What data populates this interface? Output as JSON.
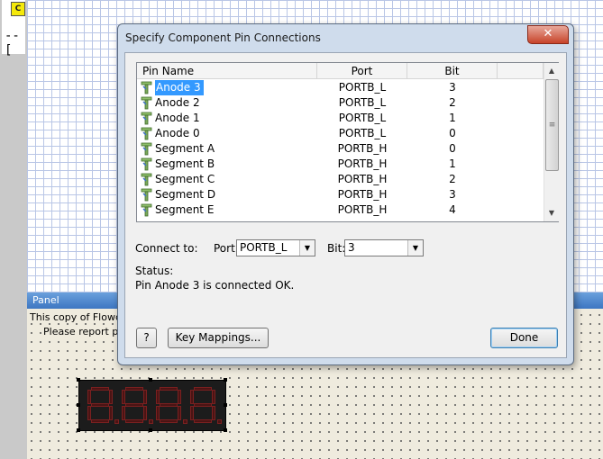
{
  "toolbar": {
    "c_badge": "C",
    "connector_glyph": "--["
  },
  "panel": {
    "title": "Panel",
    "line1": "This copy of Flowcode",
    "line2": "Please report pira"
  },
  "dialog": {
    "title": "Specify Component Pin Connections",
    "close_glyph": "✕",
    "columns": {
      "name": "Pin Name",
      "port": "Port",
      "bit": "Bit"
    },
    "rows": [
      {
        "name": "Anode 3",
        "port": "PORTB_L",
        "bit": "3"
      },
      {
        "name": "Anode 2",
        "port": "PORTB_L",
        "bit": "2"
      },
      {
        "name": "Anode 1",
        "port": "PORTB_L",
        "bit": "1"
      },
      {
        "name": "Anode 0",
        "port": "PORTB_L",
        "bit": "0"
      },
      {
        "name": "Segment A",
        "port": "PORTB_H",
        "bit": "0"
      },
      {
        "name": "Segment B",
        "port": "PORTB_H",
        "bit": "1"
      },
      {
        "name": "Segment C",
        "port": "PORTB_H",
        "bit": "2"
      },
      {
        "name": "Segment D",
        "port": "PORTB_H",
        "bit": "3"
      },
      {
        "name": "Segment E",
        "port": "PORTB_H",
        "bit": "4"
      }
    ],
    "selected_row": "Anode 3",
    "connect_label": "Connect to:",
    "port_label": "Port:",
    "port_value": "PORTB_L",
    "bit_label": "Bit:",
    "bit_value": "3",
    "status_label": "Status:",
    "status_message": "Pin Anode 3 is connected OK.",
    "help_label": "?",
    "keymap_label": "Key Mappings...",
    "done_label": "Done"
  },
  "icons": {
    "pin": "pin-icon",
    "close": "close-icon",
    "scroll_up": "scroll-up-icon",
    "scroll_down": "scroll-down-icon",
    "dropdown": "chevron-down-icon"
  },
  "colors": {
    "selection": "#3399ff",
    "close_button": "#c7432a",
    "seven_segment": "#4a1414",
    "panel_title": "#3d76c2"
  }
}
